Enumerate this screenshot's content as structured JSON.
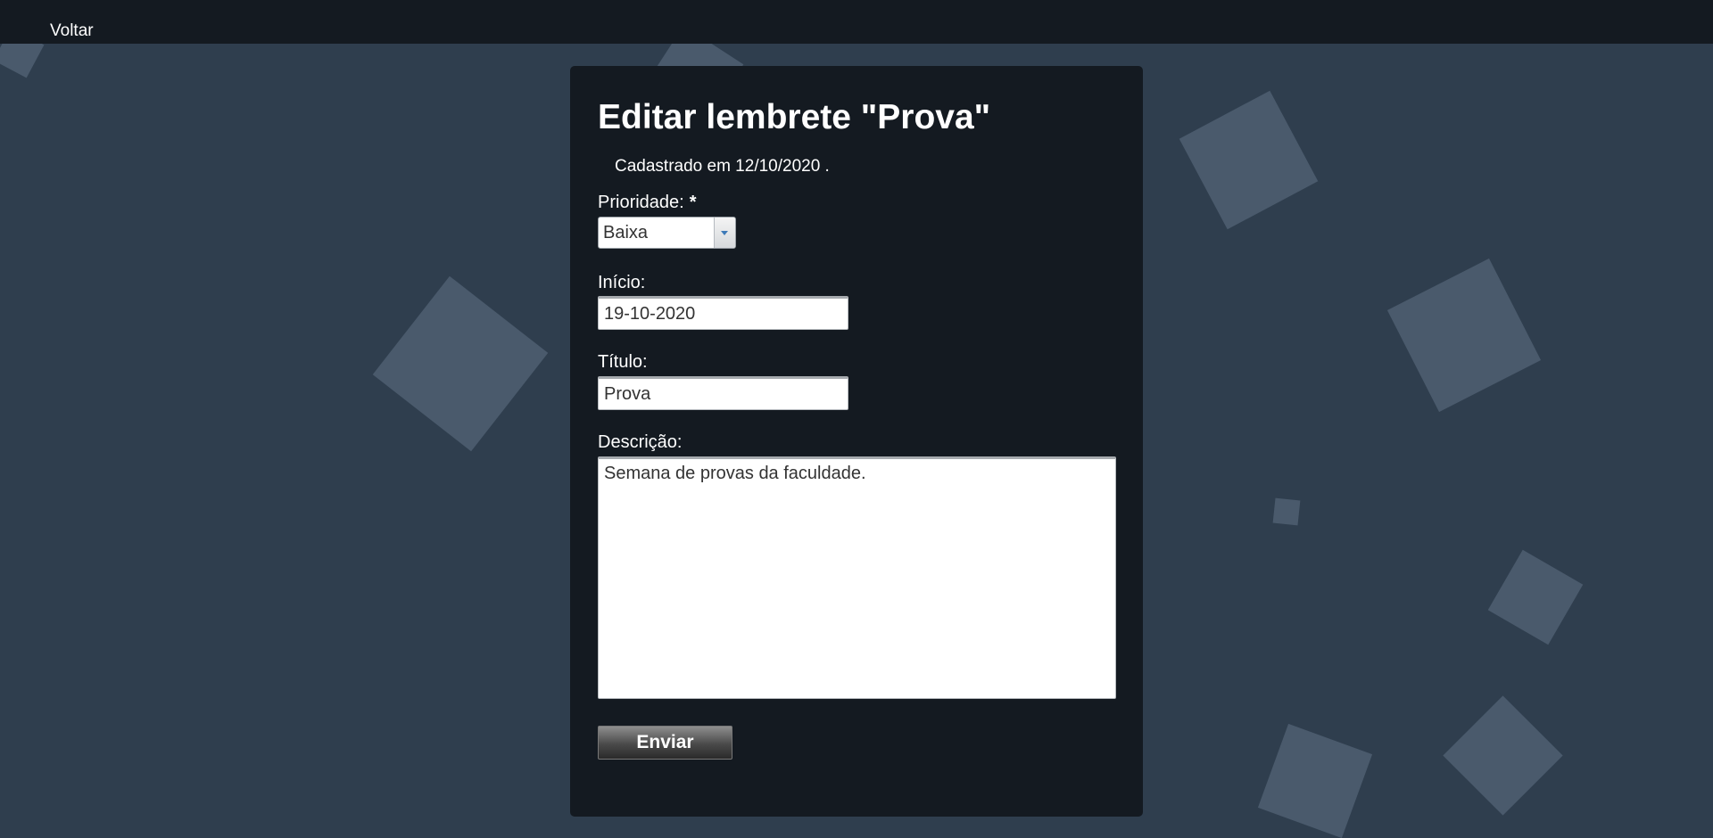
{
  "nav": {
    "back_label": "Voltar"
  },
  "form": {
    "title": "Editar lembrete \"Prova\"",
    "registered_text": "Cadastrado em 12/10/2020 .",
    "priority": {
      "label": "Prioridade:",
      "required_mark": "*",
      "selected": "Baixa"
    },
    "start": {
      "label": "Início:",
      "value": "19-10-2020"
    },
    "title_field": {
      "label": "Título:",
      "value": "Prova"
    },
    "description": {
      "label": "Descrição:",
      "value": "Semana de provas da faculdade."
    },
    "submit_label": "Enviar"
  },
  "colors": {
    "background": "#2f3e4e",
    "topbar": "#141a21",
    "card": "#141a21",
    "decor_squares": "#4a5a6c"
  }
}
